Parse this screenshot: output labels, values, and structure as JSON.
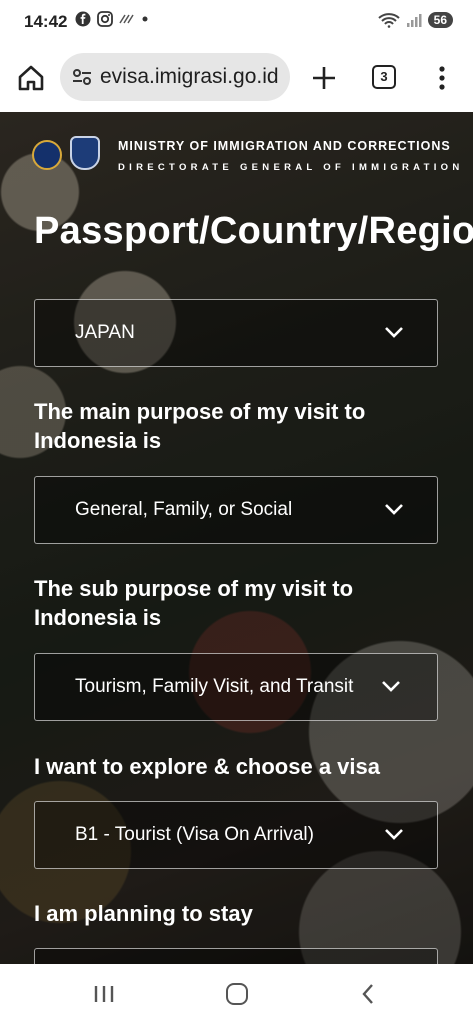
{
  "status_bar": {
    "time": "14:42",
    "battery": "56"
  },
  "browser": {
    "url": "evisa.imigrasi.go.id",
    "tab_count": "3"
  },
  "header": {
    "ministry": "MINISTRY OF IMMIGRATION AND CORRECTIONS",
    "directorate": "DIRECTORATE GENERAL OF IMMIGRATION"
  },
  "form": {
    "title": "Passport/Country/Region",
    "country_value": "JAPAN",
    "main_purpose_label": "The main purpose of my visit to Indonesia is",
    "main_purpose_value": "General, Family, or Social",
    "sub_purpose_label": "The sub purpose of my visit to Indonesia is",
    "sub_purpose_value": "Tourism, Family Visit, and Transit",
    "visa_label": "I want to explore & choose a visa",
    "visa_value": "B1 - Tourist (Visa On Arrival)",
    "stay_label": "I am planning to stay"
  },
  "colors": {
    "accent": "#ffffff",
    "toolbar_bg": "#ffffff",
    "url_pill": "#e6e6e6"
  }
}
